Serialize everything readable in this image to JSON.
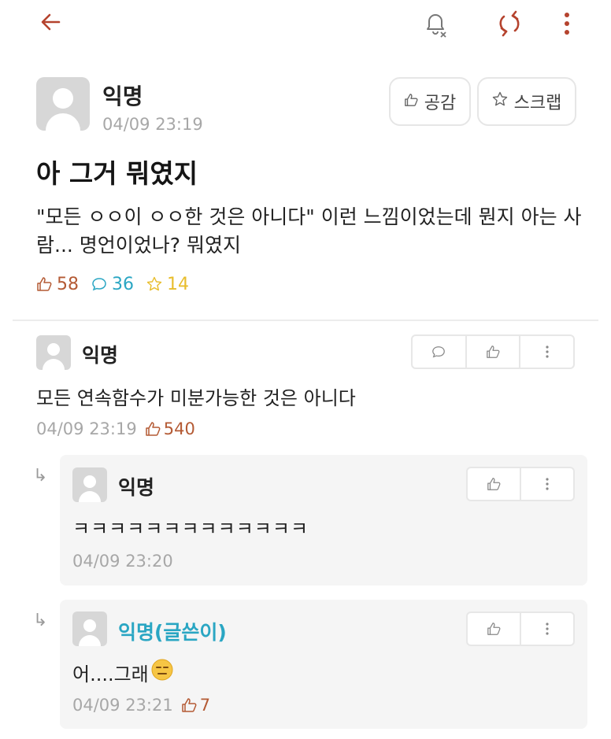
{
  "topbar": {
    "icons": [
      "back-arrow-icon",
      "notification-off-icon",
      "refresh-icon",
      "more-vertical-icon"
    ]
  },
  "post": {
    "author": "익명",
    "time": "04/09 23:19",
    "like_button": "공감",
    "scrap_button": "스크랩",
    "title": "아 그거 뭐였지",
    "body": "\"모든 ㅇㅇ이 ㅇㅇ한 것은 아니다\" 이런 느낌이었는데 뭔지 아는 사람... 명언이었나? 뭐였지",
    "likes": "58",
    "comments": "36",
    "scraps": "14"
  },
  "comments": [
    {
      "author": "익명",
      "body": "모든 연속함수가 미분가능한 것은 아니다",
      "time": "04/09 23:19",
      "likes": "540"
    }
  ],
  "replies": [
    {
      "author": "익명",
      "body": "ㅋㅋㅋㅋㅋㅋㅋㅋㅋㅋㅋㅋㅋ",
      "time": "04/09 23:20"
    },
    {
      "author": "익명(글쓴이)",
      "body": "어....그래",
      "time": "04/09 23:21",
      "likes": "7"
    }
  ],
  "colors": {
    "accent": "#b5432e",
    "like": "#b45a34",
    "comment": "#2aa6c3",
    "scrap": "#e8bd2b",
    "writer": "#2aa6c3"
  }
}
